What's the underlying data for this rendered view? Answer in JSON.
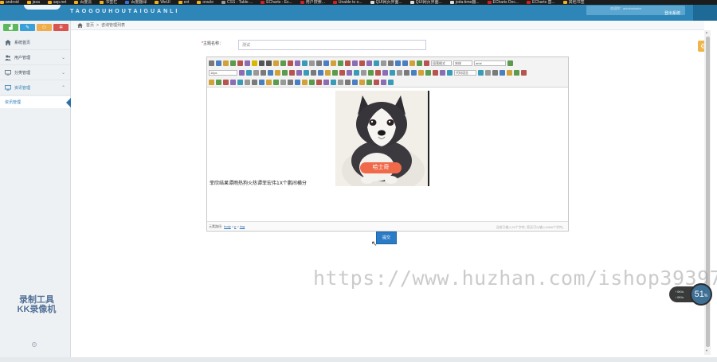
{
  "bookmarks": [
    {
      "label": "android",
      "color": "#f0b020"
    },
    {
      "label": "java",
      "color": "#f0b020"
    },
    {
      "label": "asp.net",
      "color": "#f0b020"
    },
    {
      "label": "百度云",
      "color": "#f0b020"
    },
    {
      "label": "书签栏",
      "color": "#f0b020"
    },
    {
      "label": "百度翻译",
      "color": "#3a6fd8"
    },
    {
      "label": "WeUI",
      "color": "#f0b020"
    },
    {
      "label": "ext",
      "color": "#f0b020"
    },
    {
      "label": "oracle",
      "color": "#f0b020"
    },
    {
      "label": "CSS - Table ...",
      "color": "#999"
    },
    {
      "label": "ECharts - Ex...",
      "color": "#c22"
    },
    {
      "label": "用户搜索...",
      "color": "#c22"
    },
    {
      "label": "Unable to o...",
      "color": "#c22"
    },
    {
      "label": "QUI网页界面...",
      "color": "#ddd"
    },
    {
      "label": "QUI网页界面...",
      "color": "#ddd"
    },
    {
      "label": "joda-time翻...",
      "color": "#ddd"
    },
    {
      "label": "ECharts Doc...",
      "color": "#c22"
    },
    {
      "label": "ECharts 基...",
      "color": "#c22"
    },
    {
      "label": "其他书签",
      "color": "#f0b020"
    }
  ],
  "header": {
    "app_title": "TAOGOUHOUTAIGUANLI",
    "user_name": "欢迎你：administrator",
    "logout_label": "登出系统"
  },
  "sidebar": {
    "shortcuts": [
      {
        "icon": "chart-icon",
        "glyph": "▟",
        "color": "#5cb85c"
      },
      {
        "icon": "pencil-icon",
        "glyph": "✎",
        "color": "#3aa0d8"
      },
      {
        "icon": "users-icon",
        "glyph": "⚇",
        "color": "#f0ad4e"
      },
      {
        "icon": "gears-icon",
        "glyph": "✲",
        "color": "#d9534f"
      }
    ],
    "items": [
      {
        "label": "系统首页",
        "icon": "home-icon",
        "has_arrow": false
      },
      {
        "label": "用户管理",
        "icon": "users-icon",
        "has_arrow": true
      },
      {
        "label": "分类管理",
        "icon": "monitor-icon",
        "has_arrow": true
      },
      {
        "label": "资讯管理",
        "icon": "monitor-icon",
        "has_arrow": true
      }
    ],
    "active_subitem": "资讯管理",
    "watermark_line1": "录制工具",
    "watermark_line2": "KK录像机"
  },
  "breadcrumb": {
    "home": "首页",
    "separator": ">",
    "current": "咨询管理列表"
  },
  "form": {
    "title_label": "主题名称：",
    "title_required": "*",
    "title_value": "测试",
    "submit_label": "提交"
  },
  "editor": {
    "font_size": "16px",
    "paragraph_format": "段落格式",
    "font_family_cn": "宋体",
    "font_family": "arial",
    "code_lang": "代码语言",
    "image_caption": "哈士奇",
    "content_text": "菲欣结果谭雨热狗火热谭菲宏伟1X个鹏间横分",
    "status_label": "元素路径:",
    "status_path": [
      "body",
      "p",
      "img"
    ],
    "word_count": "当前已输入20个字符, 您还可以输入9980个字符。"
  },
  "site_watermark": "https://www.huzhan.com/ishop39397",
  "speed_widget": {
    "up": "0K/s",
    "down": "0K/s",
    "value": "51",
    "unit": "%"
  },
  "colors": {
    "header": "#2e86b8",
    "accent": "#2b7cc7"
  }
}
